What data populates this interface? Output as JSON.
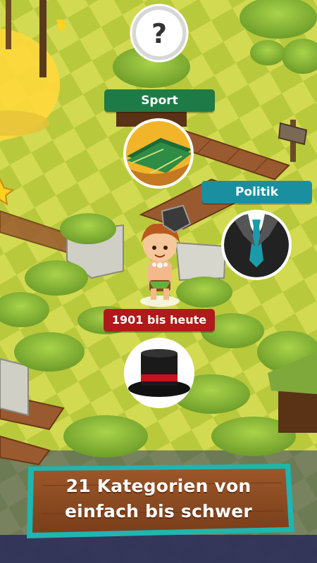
{
  "help_button": {
    "icon": "question-mark-icon",
    "glyph": "?"
  },
  "categories": [
    {
      "label": "Sport",
      "icon": "football-field-icon",
      "color": "#1e7a47"
    },
    {
      "label": "Politik",
      "icon": "suit-and-tie-icon",
      "color": "#1a8fa0"
    },
    {
      "label": "1901 bis heute",
      "icon": "top-hat-icon",
      "color": "#b01a1a"
    }
  ],
  "banner": {
    "line1": "21 Kategorien von",
    "line2": "einfach bis schwer",
    "border_color": "#1fb5b0",
    "fill_color": "#8a4a22"
  },
  "colors": {
    "grass_light": "#d6dd55",
    "grass_dark": "#b7c83a",
    "path_wood": "#9a5a30",
    "bush": "#8fbf3a"
  }
}
